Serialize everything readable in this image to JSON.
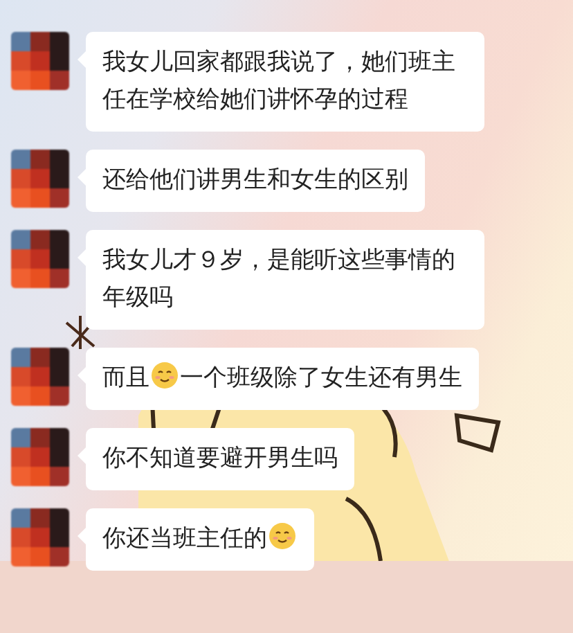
{
  "messages": [
    {
      "parts": [
        {
          "kind": "text",
          "text": "我女儿回家都跟我说了，她们班主任在学校给她们讲怀孕的过程"
        }
      ]
    },
    {
      "parts": [
        {
          "kind": "text",
          "text": "还给他们讲男生和女生的区别"
        }
      ]
    },
    {
      "parts": [
        {
          "kind": "text",
          "text": "我女儿才９岁，是能听这些事情的年级吗"
        }
      ]
    },
    {
      "parts": [
        {
          "kind": "text",
          "text": "而且"
        },
        {
          "kind": "emoji"
        },
        {
          "kind": "text",
          "text": "一个班级除了女生还有男生"
        }
      ]
    },
    {
      "parts": [
        {
          "kind": "text",
          "text": "你不知道要避开男生吗"
        }
      ]
    },
    {
      "parts": [
        {
          "kind": "text",
          "text": "你还当班主任的"
        },
        {
          "kind": "emoji"
        }
      ]
    }
  ]
}
